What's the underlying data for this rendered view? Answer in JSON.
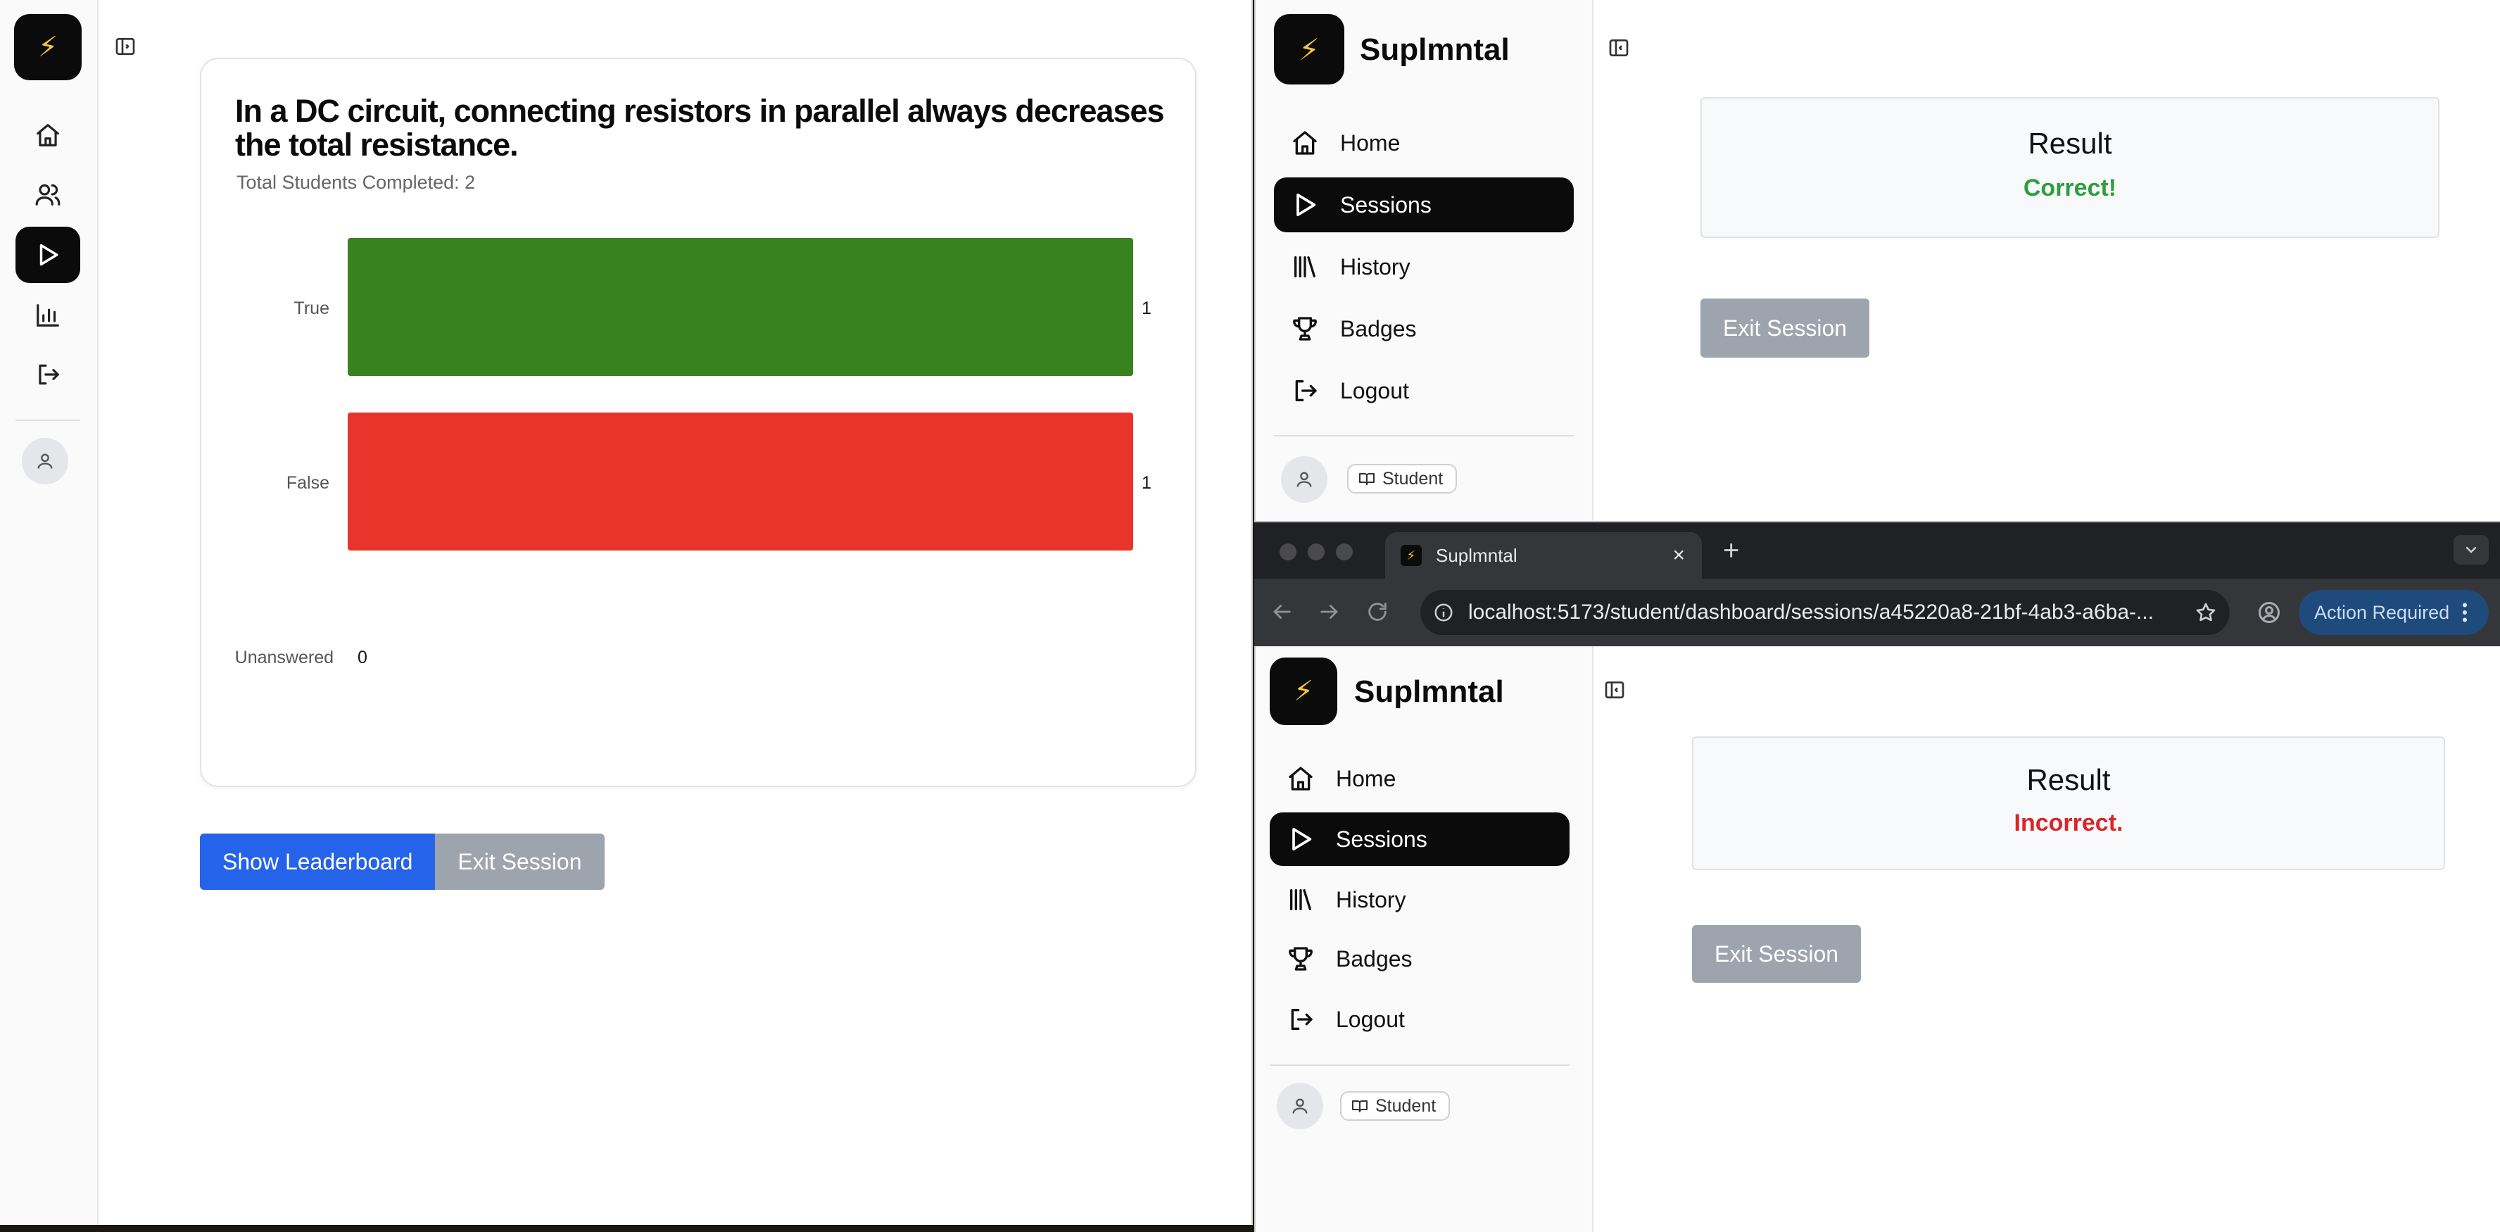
{
  "left_window": {
    "question": "In a DC circuit, connecting resistors in parallel always decreases the total resistance.",
    "completed_label": "Total Students Completed: 2",
    "buttons": {
      "leaderboard": "Show Leaderboard",
      "exit": "Exit Session"
    },
    "rail_icons": [
      "home-icon",
      "users-icon",
      "play-icon",
      "bar-chart-icon",
      "logout-icon"
    ],
    "active_rail_item": "play-icon"
  },
  "chart_data": {
    "type": "bar",
    "orientation": "horizontal",
    "categories": [
      "True",
      "False",
      "Unanswered"
    ],
    "values": [
      1,
      1,
      0
    ],
    "colors": [
      "#38821f",
      "#e8342a",
      "#9e9e9e"
    ],
    "xlim": [
      0,
      1
    ]
  },
  "brand": {
    "name": "Suplmntal",
    "logo_glyph": "⚡"
  },
  "nav": {
    "items": [
      {
        "label": "Home",
        "icon": "home-icon"
      },
      {
        "label": "Sessions",
        "icon": "play-icon"
      },
      {
        "label": "History",
        "icon": "library-icon"
      },
      {
        "label": "Badges",
        "icon": "trophy-icon"
      },
      {
        "label": "Logout",
        "icon": "logout-icon"
      }
    ],
    "active": "Sessions"
  },
  "role": "Student",
  "result_top": {
    "title": "Result",
    "message": "Correct!",
    "color": "#2e9e3f",
    "exit": "Exit Session"
  },
  "result_bottom": {
    "title": "Result",
    "message": "Incorrect.",
    "color": "#d8262b",
    "exit": "Exit Session"
  },
  "browser": {
    "tab_title": "Suplmntal",
    "url": "localhost:5173/student/dashboard/sessions/a45220a8-21bf-4ab3-a6ba-...",
    "action_label": "Action Required"
  }
}
